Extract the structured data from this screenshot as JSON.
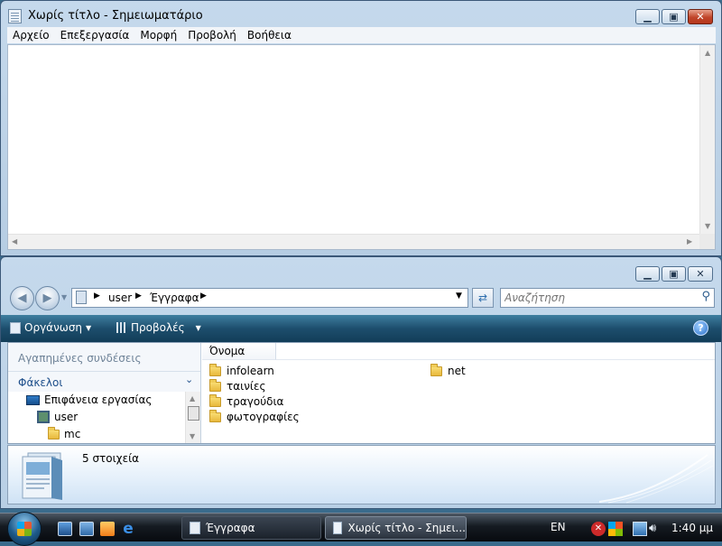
{
  "notepad": {
    "title": "Χωρίς τίτλο - Σημειωματάριο",
    "menu": [
      "Αρχείο",
      "Επεξεργασία",
      "Μορφή",
      "Προβολή",
      "Βοήθεια"
    ],
    "content": ""
  },
  "explorer": {
    "breadcrumb": [
      "user",
      "Έγγραφα"
    ],
    "search_placeholder": "Αναζήτηση",
    "toolbar": {
      "organize": "Οργάνωση",
      "views": "Προβολές"
    },
    "nav": {
      "favorites": "Αγαπημένες συνδέσεις",
      "folders": "Φάκελοι",
      "tree": [
        "Επιφάνεια εργασίας",
        "user",
        "mc"
      ]
    },
    "column_name": "Όνομα",
    "files": [
      "infolearn",
      "ταινίες",
      "τραγούδια",
      "φωτογραφίες",
      "net"
    ],
    "item_count": "5 στοιχεία"
  },
  "taskbar": {
    "tasks": [
      "Έγγραφα",
      "Χωρίς τίτλο - Σημει..."
    ],
    "language": "EN",
    "clock": "1:40 μμ"
  },
  "icons": {
    "minimize": "minimize-icon",
    "maximize": "maximize-icon",
    "close": "close-icon",
    "folder": "folder-icon",
    "search": "search-icon",
    "help": "help-icon"
  }
}
